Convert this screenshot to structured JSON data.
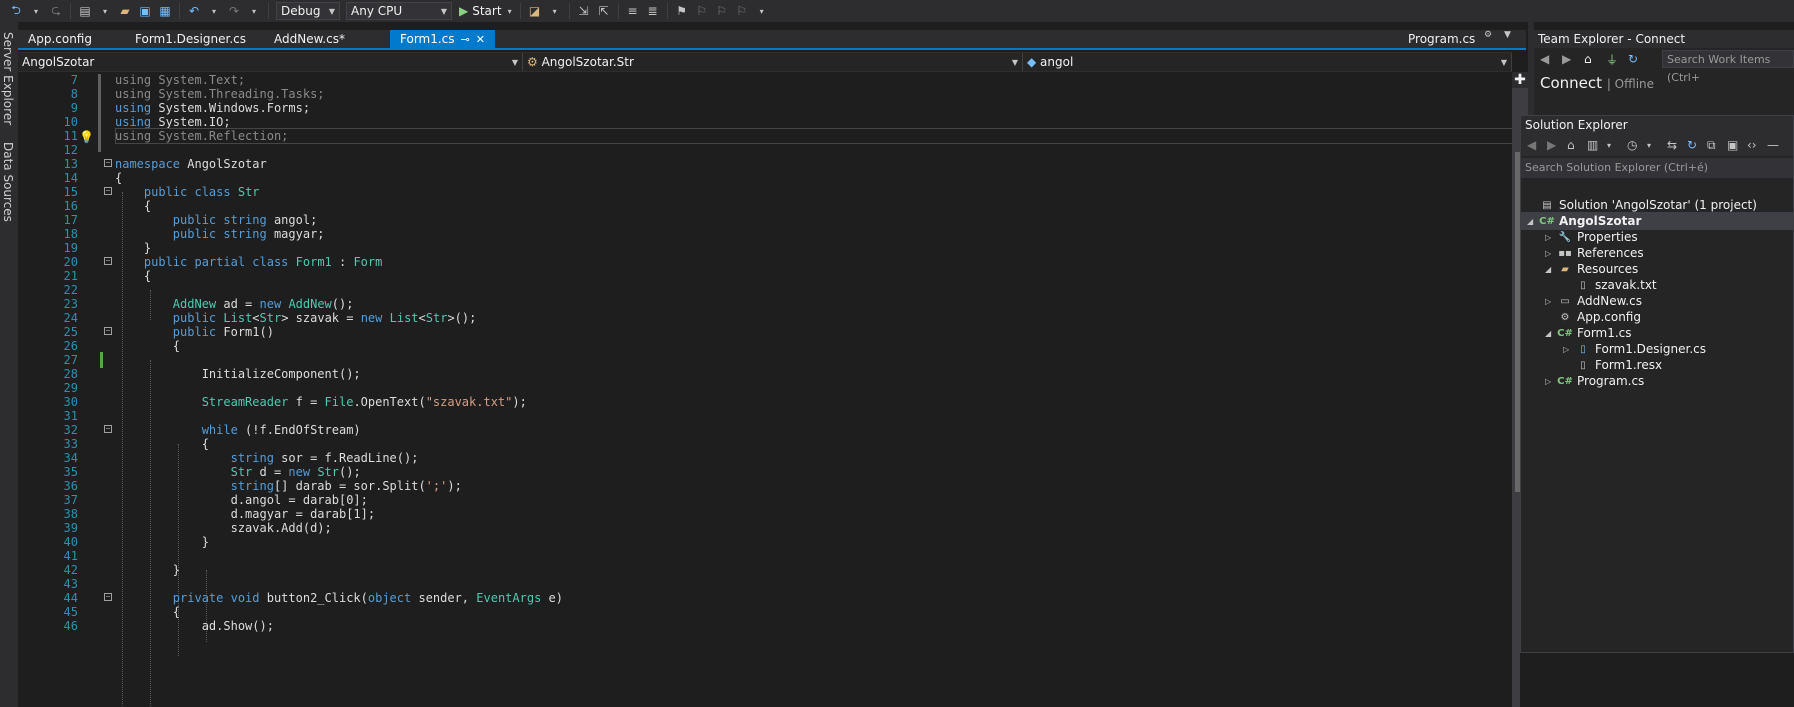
{
  "toolbar": {
    "configuration": "Debug",
    "platform": "Any CPU",
    "start_label": "Start"
  },
  "left_strip": {
    "server_explorer": "Server Explorer",
    "data_sources": "Data Sources"
  },
  "tabs": [
    {
      "label": "App.config"
    },
    {
      "label": "Form1.Designer.cs"
    },
    {
      "label": "AddNew.cs*"
    },
    {
      "label": "Form1.cs"
    }
  ],
  "right_tab": "Program.cs",
  "navbar": {
    "project": "AngolSzotar",
    "class": "AngolSzotar.Str",
    "member": "angol"
  },
  "code_lines": [
    {
      "n": "7",
      "tokens": [
        [
          "dim",
          "using System.Text;"
        ]
      ]
    },
    {
      "n": "8",
      "tokens": [
        [
          "dim",
          "using System.Threading.Tasks;"
        ]
      ]
    },
    {
      "n": "9",
      "tokens": [
        [
          "kw",
          "using"
        ],
        [
          "t",
          " System.Windows.Forms;"
        ]
      ]
    },
    {
      "n": "10",
      "tokens": [
        [
          "kw",
          "using"
        ],
        [
          "t",
          " System.IO;"
        ]
      ]
    },
    {
      "n": "11",
      "tokens": [
        [
          "dim",
          "using System.Reflection;"
        ]
      ]
    },
    {
      "n": "12",
      "tokens": []
    },
    {
      "n": "13",
      "tokens": [
        [
          "kw",
          "namespace"
        ],
        [
          "t",
          " AngolSzotar"
        ]
      ]
    },
    {
      "n": "14",
      "tokens": [
        [
          "t",
          "{"
        ]
      ]
    },
    {
      "n": "15",
      "tokens": [
        [
          "t",
          "    "
        ],
        [
          "kw",
          "public class"
        ],
        [
          "t",
          " "
        ],
        [
          "ty",
          "Str"
        ]
      ]
    },
    {
      "n": "16",
      "tokens": [
        [
          "t",
          "    {"
        ]
      ]
    },
    {
      "n": "17",
      "tokens": [
        [
          "t",
          "        "
        ],
        [
          "kw",
          "public string"
        ],
        [
          "t",
          " angol;"
        ]
      ]
    },
    {
      "n": "18",
      "tokens": [
        [
          "t",
          "        "
        ],
        [
          "kw",
          "public string"
        ],
        [
          "t",
          " magyar;"
        ]
      ]
    },
    {
      "n": "19",
      "tokens": [
        [
          "t",
          "    }"
        ]
      ]
    },
    {
      "n": "20",
      "tokens": [
        [
          "t",
          "    "
        ],
        [
          "kw",
          "public partial class"
        ],
        [
          "t",
          " "
        ],
        [
          "ty",
          "Form1"
        ],
        [
          "t",
          " : "
        ],
        [
          "ty",
          "Form"
        ]
      ]
    },
    {
      "n": "21",
      "tokens": [
        [
          "t",
          "    {"
        ]
      ]
    },
    {
      "n": "22",
      "tokens": []
    },
    {
      "n": "23",
      "tokens": [
        [
          "t",
          "        "
        ],
        [
          "ty",
          "AddNew"
        ],
        [
          "t",
          " ad = "
        ],
        [
          "kw",
          "new"
        ],
        [
          "t",
          " "
        ],
        [
          "ty",
          "AddNew"
        ],
        [
          "t",
          "();"
        ]
      ]
    },
    {
      "n": "24",
      "tokens": [
        [
          "t",
          "        "
        ],
        [
          "kw",
          "public"
        ],
        [
          "t",
          " "
        ],
        [
          "ty",
          "List"
        ],
        [
          "t",
          "<"
        ],
        [
          "ty",
          "Str"
        ],
        [
          "t",
          "> szavak = "
        ],
        [
          "kw",
          "new"
        ],
        [
          "t",
          " "
        ],
        [
          "ty",
          "List"
        ],
        [
          "t",
          "<"
        ],
        [
          "ty",
          "Str"
        ],
        [
          "t",
          ">();"
        ]
      ]
    },
    {
      "n": "25",
      "tokens": [
        [
          "t",
          "        "
        ],
        [
          "kw",
          "public"
        ],
        [
          "t",
          " Form1()"
        ]
      ]
    },
    {
      "n": "26",
      "tokens": [
        [
          "t",
          "        {"
        ]
      ]
    },
    {
      "n": "27",
      "tokens": []
    },
    {
      "n": "28",
      "tokens": [
        [
          "t",
          "            InitializeComponent();"
        ]
      ]
    },
    {
      "n": "29",
      "tokens": []
    },
    {
      "n": "30",
      "tokens": [
        [
          "t",
          "            "
        ],
        [
          "ty",
          "StreamReader"
        ],
        [
          "t",
          " f = "
        ],
        [
          "ty",
          "File"
        ],
        [
          "t",
          ".OpenText("
        ],
        [
          "st",
          "\"szavak.txt\""
        ],
        [
          "t",
          ");"
        ]
      ]
    },
    {
      "n": "31",
      "tokens": []
    },
    {
      "n": "32",
      "tokens": [
        [
          "t",
          "            "
        ],
        [
          "kw",
          "while"
        ],
        [
          "t",
          " (!f.EndOfStream)"
        ]
      ]
    },
    {
      "n": "33",
      "tokens": [
        [
          "t",
          "            {"
        ]
      ]
    },
    {
      "n": "34",
      "tokens": [
        [
          "t",
          "                "
        ],
        [
          "kw",
          "string"
        ],
        [
          "t",
          " sor = f.ReadLine();"
        ]
      ]
    },
    {
      "n": "35",
      "tokens": [
        [
          "t",
          "                "
        ],
        [
          "ty",
          "Str"
        ],
        [
          "t",
          " d = "
        ],
        [
          "kw",
          "new"
        ],
        [
          "t",
          " "
        ],
        [
          "ty",
          "Str"
        ],
        [
          "t",
          "();"
        ]
      ]
    },
    {
      "n": "36",
      "tokens": [
        [
          "t",
          "                "
        ],
        [
          "kw",
          "string"
        ],
        [
          "t",
          "[] darab = sor.Split("
        ],
        [
          "st",
          "';'"
        ],
        [
          "t",
          ");"
        ]
      ]
    },
    {
      "n": "37",
      "tokens": [
        [
          "t",
          "                d.angol = darab[0];"
        ]
      ]
    },
    {
      "n": "38",
      "tokens": [
        [
          "t",
          "                d.magyar = darab[1];"
        ]
      ]
    },
    {
      "n": "39",
      "tokens": [
        [
          "t",
          "                szavak.Add(d);"
        ]
      ]
    },
    {
      "n": "40",
      "tokens": [
        [
          "t",
          "            }"
        ]
      ]
    },
    {
      "n": "41",
      "tokens": []
    },
    {
      "n": "42",
      "tokens": [
        [
          "t",
          "        }"
        ]
      ]
    },
    {
      "n": "43",
      "tokens": []
    },
    {
      "n": "44",
      "tokens": [
        [
          "t",
          "        "
        ],
        [
          "kw",
          "private void"
        ],
        [
          "t",
          " button2_Click("
        ],
        [
          "kw",
          "object"
        ],
        [
          "t",
          " sender, "
        ],
        [
          "ty",
          "EventArgs"
        ],
        [
          "t",
          " e)"
        ]
      ]
    },
    {
      "n": "45",
      "tokens": [
        [
          "t",
          "        {"
        ]
      ]
    },
    {
      "n": "46",
      "tokens": [
        [
          "t",
          "            ad.Show();"
        ]
      ]
    }
  ],
  "team_explorer": {
    "title": "Team Explorer - Connect",
    "search_placeholder": "Search Work Items (Ctrl+",
    "connect": "Connect",
    "status": "Offline"
  },
  "solution_explorer": {
    "title": "Solution Explorer",
    "search_placeholder": "Search Solution Explorer (Ctrl+é)",
    "items": [
      {
        "label": "Solution 'AngolSzotar' (1 project)",
        "depth": 0,
        "expander": "",
        "icon": "solution-icon"
      },
      {
        "label": "AngolSzotar",
        "depth": 0,
        "expander": "open",
        "icon": "csharp-project-icon",
        "selected": true
      },
      {
        "label": "Properties",
        "depth": 1,
        "expander": "closed",
        "icon": "wrench-icon"
      },
      {
        "label": "References",
        "depth": 1,
        "expander": "closed",
        "icon": "references-icon"
      },
      {
        "label": "Resources",
        "depth": 1,
        "expander": "open",
        "icon": "folder-icon"
      },
      {
        "label": "szavak.txt",
        "depth": 2,
        "expander": "",
        "icon": "text-file-icon"
      },
      {
        "label": "AddNew.cs",
        "depth": 1,
        "expander": "closed",
        "icon": "form-icon"
      },
      {
        "label": "App.config",
        "depth": 1,
        "expander": "",
        "icon": "config-file-icon"
      },
      {
        "label": "Form1.cs",
        "depth": 1,
        "expander": "open",
        "icon": "csharp-file-icon"
      },
      {
        "label": "Form1.Designer.cs",
        "depth": 2,
        "expander": "closed",
        "icon": "designer-file-icon"
      },
      {
        "label": "Form1.resx",
        "depth": 2,
        "expander": "",
        "icon": "resx-file-icon"
      },
      {
        "label": "Program.cs",
        "depth": 1,
        "expander": "closed",
        "icon": "csharp-file-icon"
      }
    ]
  }
}
